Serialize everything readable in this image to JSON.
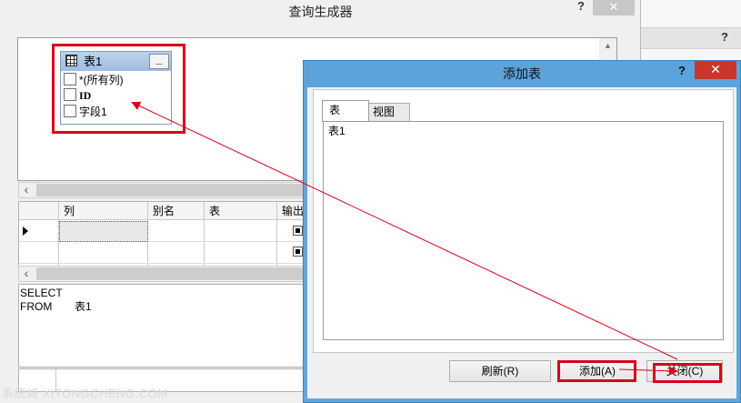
{
  "query_builder": {
    "title": "查询生成器",
    "help_label": "?",
    "close_label": "✕",
    "table": {
      "name": "表1",
      "minimize_label": "_",
      "fields": [
        "*(所有列)",
        "ID",
        "字段1"
      ]
    },
    "grid": {
      "columns": [
        "列",
        "别名",
        "表",
        "输出"
      ]
    },
    "sql": {
      "select_keyword": "SELECT",
      "from_keyword": "FROM",
      "from_table": "表1"
    },
    "watermark": "系统城 XITONGCHENG.COM"
  },
  "background_window": {
    "help_label": "?",
    "close_label": "✕"
  },
  "add_table_dialog": {
    "title": "添加表",
    "help_label": "?",
    "close_label": "✕",
    "tabs": [
      "表",
      "视图"
    ],
    "active_tab": "表",
    "list_items": [
      "表1"
    ],
    "buttons": {
      "refresh": "刷新(R)",
      "add": "添加(A)",
      "close": "关闭(C)"
    }
  },
  "colors": {
    "highlight_red": "#d9001b",
    "dialog_titlebar": "#5ba3da",
    "close_button_red": "#c7382b"
  }
}
